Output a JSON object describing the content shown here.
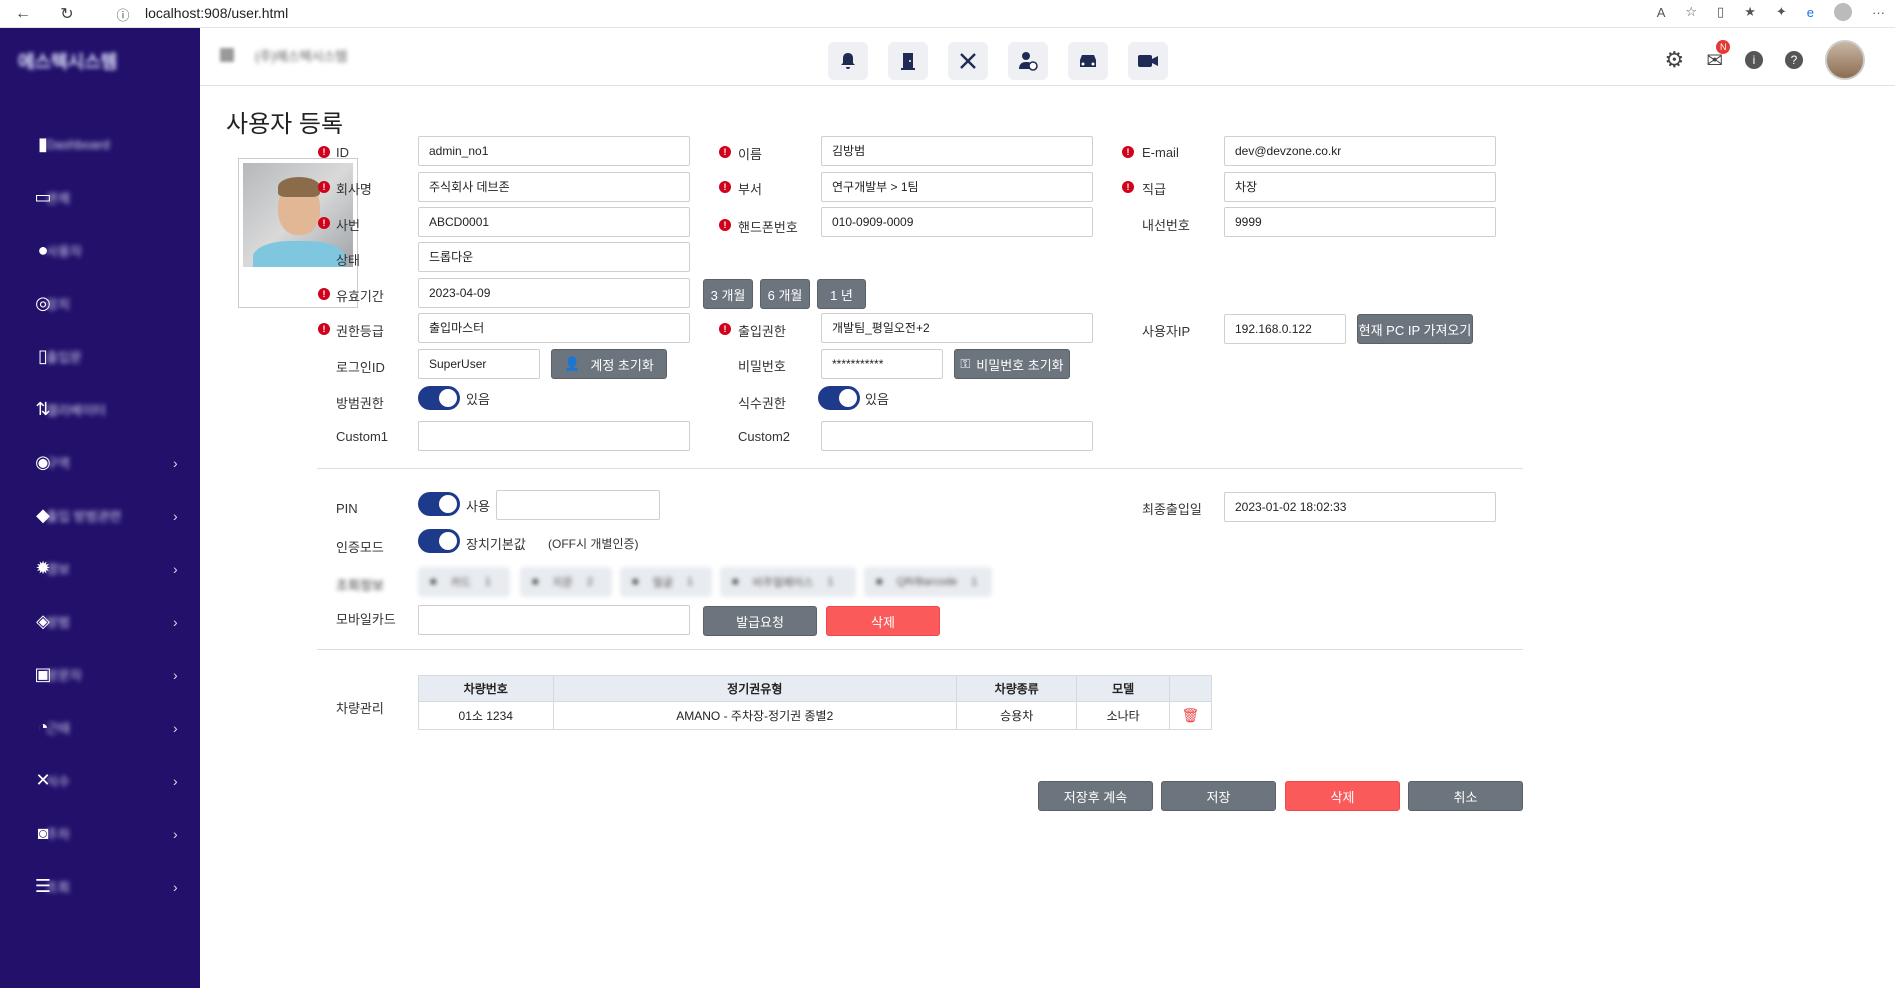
{
  "browser": {
    "url": "localhost:908/user.html"
  },
  "sidebar": {
    "logo": "에스텍시스템",
    "items": [
      {
        "label": "Dashboard",
        "icon": "bar-chart-icon",
        "chevron": false
      },
      {
        "label": "관제",
        "icon": "monitor-icon",
        "chevron": false
      },
      {
        "label": "사용자",
        "icon": "user-icon",
        "chevron": false
      },
      {
        "label": "장치",
        "icon": "network-icon",
        "chevron": false
      },
      {
        "label": "출입문",
        "icon": "door-icon",
        "chevron": false
      },
      {
        "label": "엘리베이터",
        "icon": "elevator-icon",
        "chevron": false
      },
      {
        "label": "구역",
        "icon": "location-icon",
        "chevron": true
      },
      {
        "label": "출입 방범관련",
        "icon": "shield-lock-icon",
        "chevron": true
      },
      {
        "label": "경보",
        "icon": "alarm-icon",
        "chevron": true
      },
      {
        "label": "방범",
        "icon": "shield-icon",
        "chevron": true
      },
      {
        "label": "방문자",
        "icon": "badge-icon",
        "chevron": true
      },
      {
        "label": "근태",
        "icon": "user-clock-icon",
        "chevron": true
      },
      {
        "label": "식수",
        "icon": "utensils-icon",
        "chevron": true
      },
      {
        "label": "주차",
        "icon": "car-icon",
        "chevron": true
      },
      {
        "label": "조회",
        "icon": "list-icon",
        "chevron": true
      }
    ]
  },
  "topbar": {
    "company": "(주)에스텍시스템",
    "icons": [
      "bell-icon",
      "door-icon",
      "utensils-icon",
      "user-clock-icon",
      "car-icon",
      "video-icon"
    ],
    "notification_badge": "N"
  },
  "page": {
    "title": "사용자 등록",
    "fields": {
      "id": {
        "label": "ID",
        "value": "admin_no1"
      },
      "name": {
        "label": "이름",
        "value": "김방범"
      },
      "email": {
        "label": "E-mail",
        "value": "dev@devzone.co.kr"
      },
      "company": {
        "label": "회사명",
        "value": "주식회사 데브존"
      },
      "dept": {
        "label": "부서",
        "value": "연구개발부 > 1팀"
      },
      "position": {
        "label": "직급",
        "value": "차장"
      },
      "emp_no": {
        "label": "사번",
        "value": "ABCD0001"
      },
      "phone": {
        "label": "핸드폰번호",
        "value": "010-0909-0009"
      },
      "ext": {
        "label": "내선번호",
        "value": "9999"
      },
      "status": {
        "label": "상태",
        "value": "드롭다운"
      },
      "valid": {
        "label": "유효기간",
        "value": "2023-04-09"
      },
      "level": {
        "label": "권한등급",
        "value": "출입마스터"
      },
      "access": {
        "label": "출입권한",
        "value": "개발팀_평일오전+2"
      },
      "user_ip": {
        "label": "사용자IP",
        "value": "192.168.0.122"
      },
      "login_id": {
        "label": "로그인ID",
        "value": "SuperUser"
      },
      "password": {
        "label": "비밀번호",
        "value": "***********"
      },
      "security": {
        "label": "방범권한",
        "value": "있음"
      },
      "meal": {
        "label": "식수권한",
        "value": "있음"
      },
      "custom1": {
        "label": "Custom1",
        "value": ""
      },
      "custom2": {
        "label": "Custom2",
        "value": ""
      },
      "pin": {
        "label": "PIN",
        "value": "사용"
      },
      "last_access": {
        "label": "최종출입일",
        "value": "2023-01-02 18:02:33"
      },
      "auth_mode": {
        "label": "인증모드",
        "value": "장치기본값",
        "note": "(OFF시 개별인증)"
      },
      "auth_info": {
        "label": "조회정보"
      },
      "mobile_card": {
        "label": "모바일카드",
        "value": ""
      },
      "vehicle": {
        "label": "차량관리"
      }
    },
    "buttons": {
      "m3": "3 개월",
      "m6": "6 개월",
      "y1": "1 년",
      "get_ip": "현재 PC IP 가져오기",
      "reset_account": "계정 초기화",
      "reset_password": "비밀번호 초기화",
      "issue": "발급요청",
      "delete_card": "삭제",
      "save_continue": "저장후 계속",
      "save": "저장",
      "delete": "삭제",
      "cancel": "취소"
    },
    "auth_chips": [
      {
        "label": "카드",
        "count": "1"
      },
      {
        "label": "지문",
        "count": "2"
      },
      {
        "label": "얼굴",
        "count": "1"
      },
      {
        "label": "비주얼페이스",
        "count": "1"
      },
      {
        "label": "QR/Barcode",
        "count": "1"
      }
    ],
    "vehicle_table": {
      "headers": [
        "차량번호",
        "정기권유형",
        "차량종류",
        "모델",
        ""
      ],
      "rows": [
        [
          "01소 1234",
          "AMANO - 주차장-정기권 종별2",
          "승용차",
          "소나타"
        ]
      ]
    }
  }
}
